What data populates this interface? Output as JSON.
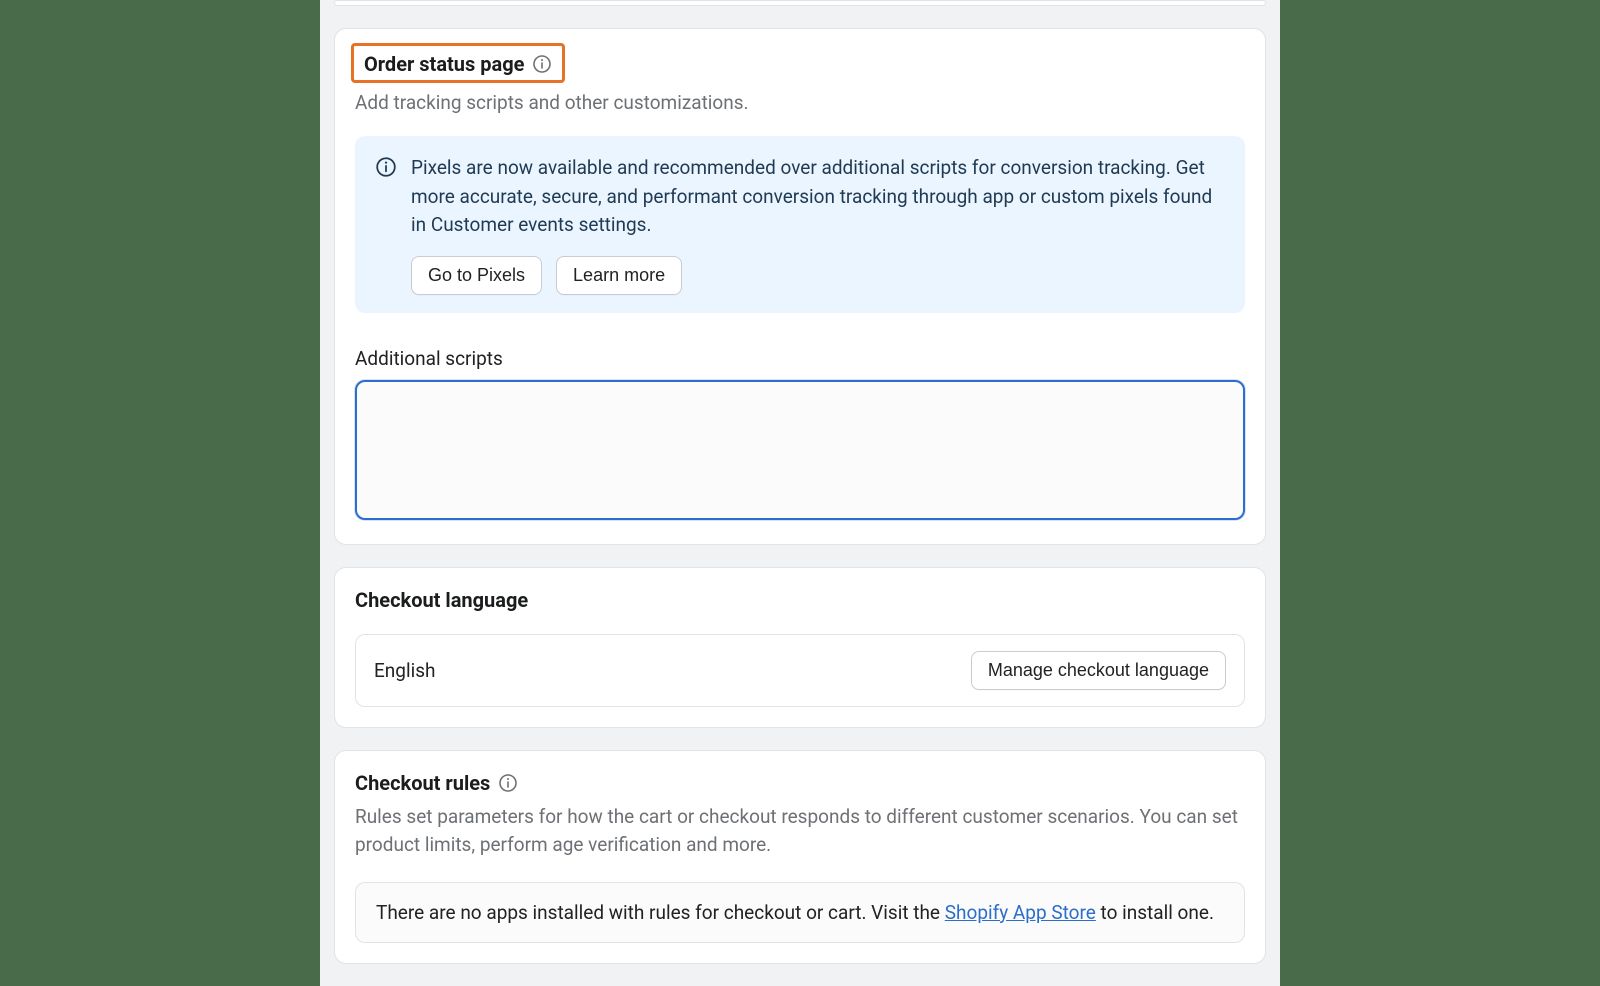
{
  "order_status": {
    "title": "Order status page",
    "subtitle": "Add tracking scripts and other customizations.",
    "banner_text": "Pixels are now available and recommended over additional scripts for conversion tracking. Get more accurate, secure, and performant conversion tracking through app or custom pixels found in Customer events settings.",
    "go_to_pixels": "Go to Pixels",
    "learn_more": "Learn more",
    "scripts_label": "Additional scripts",
    "scripts_value": ""
  },
  "checkout_language": {
    "title": "Checkout language",
    "current": "English",
    "manage_label": "Manage checkout language"
  },
  "checkout_rules": {
    "title": "Checkout rules",
    "description": "Rules set parameters for how the cart or checkout responds to different customer scenarios. You can set product limits, perform age verification and more.",
    "empty_prefix": "There are no apps installed with rules for checkout or cart. Visit the ",
    "empty_link": "Shopify App Store",
    "empty_suffix": " to install one."
  }
}
